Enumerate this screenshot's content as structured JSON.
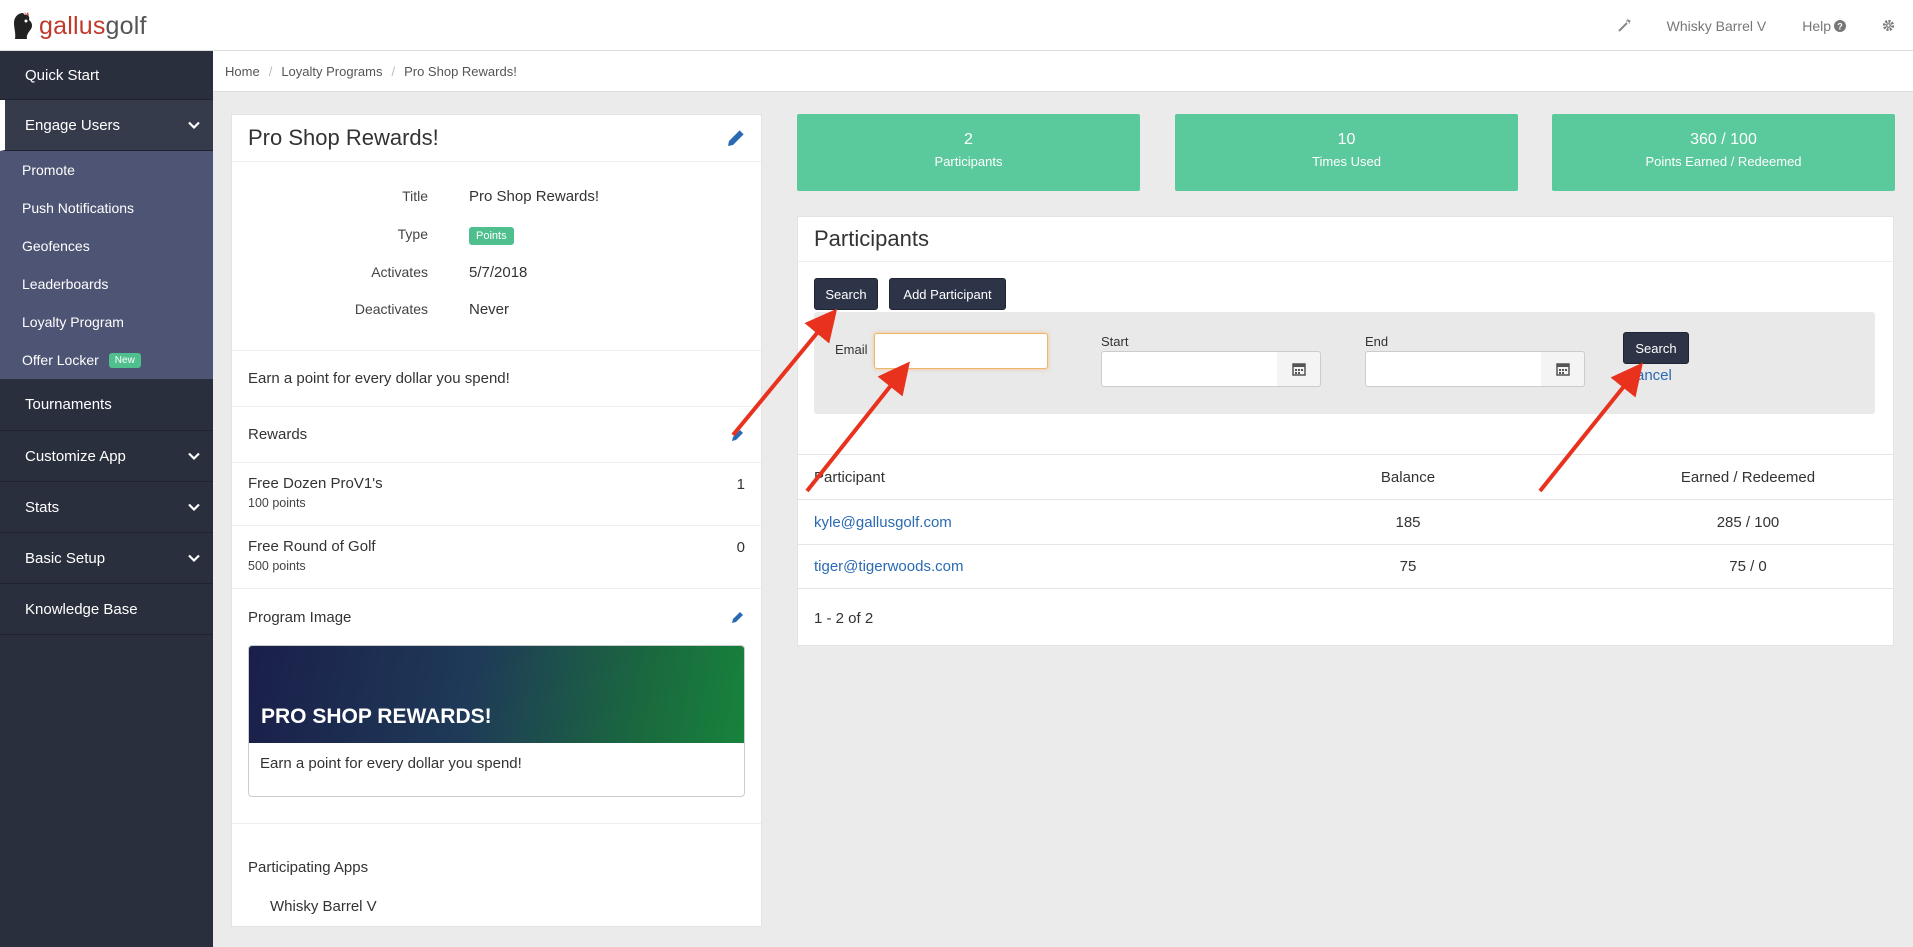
{
  "topbar": {
    "logo": {
      "part1": "gallus",
      "part2": "golf"
    },
    "nav": {
      "account": "Whisky Barrel V",
      "help": "Help"
    }
  },
  "sidebar": {
    "items": [
      {
        "label": "Quick Start"
      },
      {
        "label": "Engage Users"
      },
      {
        "label": "Tournaments"
      },
      {
        "label": "Customize App"
      },
      {
        "label": "Stats"
      },
      {
        "label": "Basic Setup"
      },
      {
        "label": "Knowledge Base"
      }
    ],
    "engage_sub": [
      {
        "label": "Promote"
      },
      {
        "label": "Push Notifications"
      },
      {
        "label": "Geofences"
      },
      {
        "label": "Leaderboards"
      },
      {
        "label": "Loyalty Program"
      },
      {
        "label": "Offer Locker",
        "badge": "New"
      }
    ]
  },
  "breadcrumb": [
    "Home",
    "Loyalty Programs",
    "Pro Shop Rewards!"
  ],
  "program": {
    "heading": "Pro Shop Rewards!",
    "details": {
      "title_label": "Title",
      "title_value": "Pro Shop Rewards!",
      "type_label": "Type",
      "type_value": "Points",
      "activates_label": "Activates",
      "activates_value": "5/7/2018",
      "deactivates_label": "Deactivates",
      "deactivates_value": "Never"
    },
    "description": "Earn a point for every dollar you spend!",
    "rewards_title": "Rewards",
    "rewards": [
      {
        "name": "Free Dozen ProV1's",
        "points": "100 points",
        "count": "1"
      },
      {
        "name": "Free Round of Golf",
        "points": "500 points",
        "count": "0"
      }
    ],
    "image_title": "Program Image",
    "image_banner_text": "PRO SHOP REWARDS!",
    "image_caption": "Earn a point for every dollar you spend!",
    "apps_title": "Participating Apps",
    "apps": [
      "Whisky Barrel V"
    ]
  },
  "stats": [
    {
      "value": "2",
      "label": "Participants"
    },
    {
      "value": "10",
      "label": "Times Used"
    },
    {
      "value": "360 / 100",
      "label": "Points Earned / Redeemed"
    }
  ],
  "participants": {
    "title": "Participants",
    "search_button": "Search",
    "add_button": "Add Participant",
    "filter": {
      "email_label": "Email",
      "email_value": "",
      "start_label": "Start",
      "start_value": "",
      "end_label": "End",
      "end_value": "",
      "search_button": "Search",
      "cancel_link": "ancel"
    },
    "columns": [
      "Participant",
      "Balance",
      "Earned / Redeemed"
    ],
    "rows": [
      {
        "email": "kyle@gallusgolf.com",
        "balance": "185",
        "earned_redeemed": "285 / 100"
      },
      {
        "email": "tiger@tigerwoods.com",
        "balance": "75",
        "earned_redeemed": "75 / 0"
      }
    ],
    "pager": "1 - 2 of 2"
  },
  "colors": {
    "sidebar_bg": "#2a2f3d",
    "submenu_bg": "#4e5473",
    "stat_green": "#5ac99c",
    "button_dark": "#2d3447",
    "link_blue": "#2a6ab3",
    "arrow_red": "#e8321e"
  }
}
